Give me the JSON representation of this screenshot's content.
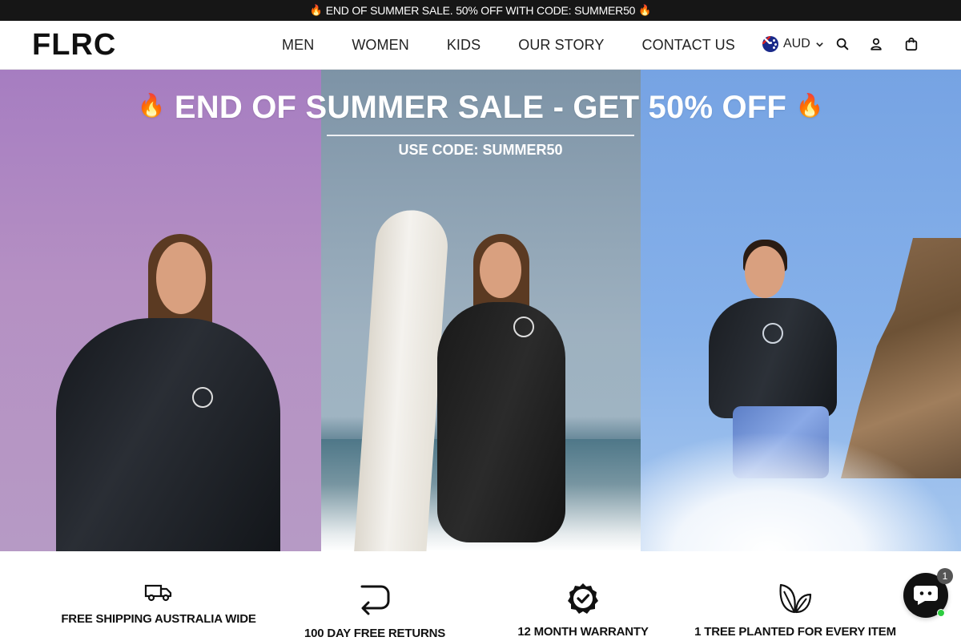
{
  "announcement": {
    "flame": "🔥",
    "text": "END OF SUMMER SALE. 50% OFF WITH CODE: SUMMER50"
  },
  "header": {
    "logo": "FLRC",
    "nav": [
      "MEN",
      "WOMEN",
      "KIDS",
      "OUR STORY",
      "CONTACT US"
    ],
    "currency": "AUD",
    "icons": [
      "australia-flag-icon",
      "chevron-down-icon",
      "search-icon",
      "account-icon",
      "cart-icon"
    ]
  },
  "hero": {
    "flame": "🔥",
    "title": "END OF SUMMER SALE - GET 50% OFF",
    "code": "USE CODE: SUMMER50",
    "chest_logo": "FLRC"
  },
  "features": [
    {
      "icon": "truck-icon",
      "label": "FREE SHIPPING AUSTRALIA WIDE"
    },
    {
      "icon": "return-arrow-icon",
      "label": "100 DAY FREE RETURNS"
    },
    {
      "icon": "badge-check-icon",
      "label": "12 MONTH WARRANTY"
    },
    {
      "icon": "leaf-icon",
      "label": "1 TREE PLANTED FOR EVERY ITEM"
    }
  ],
  "chat": {
    "badge": "1"
  },
  "colors": {
    "announcement_bg": "#161616",
    "text": "#111111",
    "online": "#2ecc40"
  }
}
